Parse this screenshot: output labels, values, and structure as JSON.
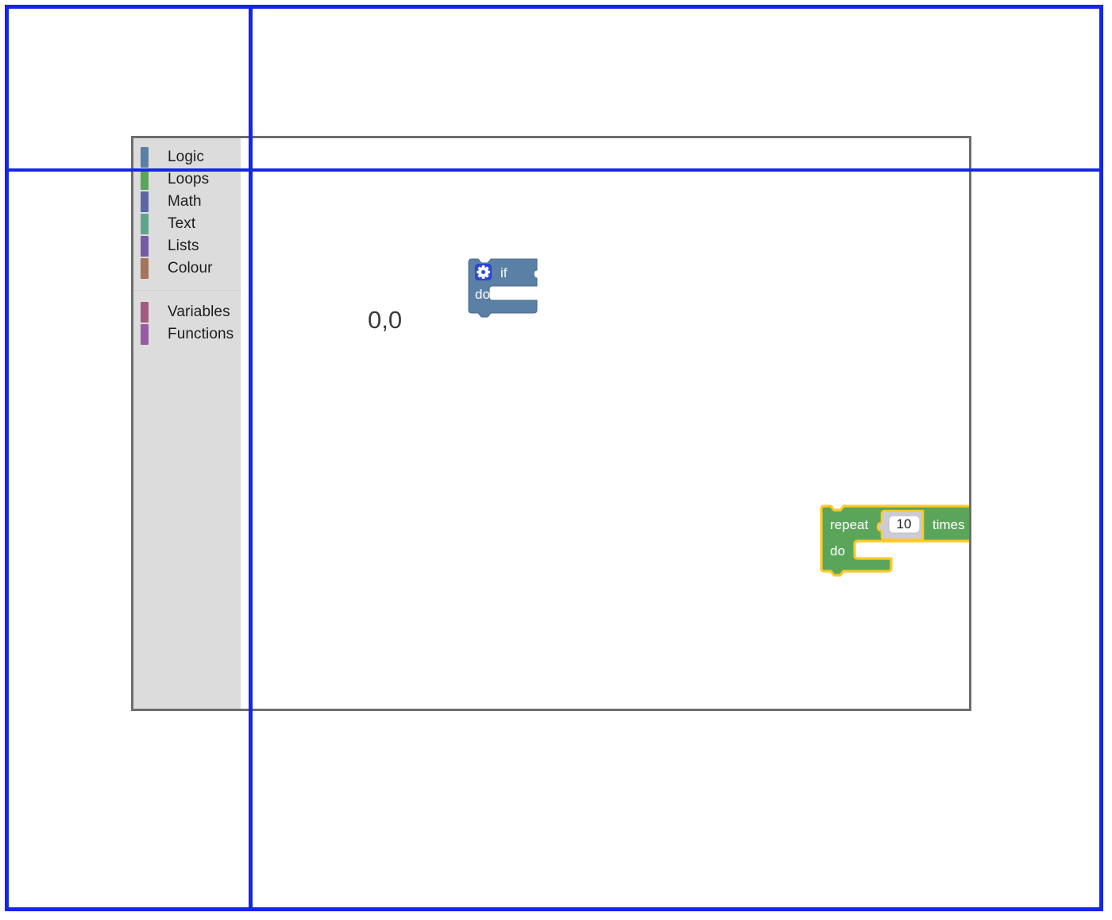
{
  "page": {
    "guides": {
      "frame_color": "#1426e8",
      "vertical_line_x": "313",
      "horizontal_line_y": "212"
    }
  },
  "workspace": {
    "origin_label": "0,0",
    "grid": {
      "spacing": "28.6",
      "dot_color": "#d4d0d4"
    },
    "background_color": "#ffffff",
    "border_color": "#6d6d6d"
  },
  "toolbox": {
    "background_color": "#dcdcdc",
    "categories": [
      {
        "label": "Logic",
        "color": "#5b80a5"
      },
      {
        "label": "Loops",
        "color": "#5ba55b"
      },
      {
        "label": "Math",
        "color": "#5b67a5"
      },
      {
        "label": "Text",
        "color": "#5ba58c"
      },
      {
        "label": "Lists",
        "color": "#745ba5"
      },
      {
        "label": "Colour",
        "color": "#a5745b"
      }
    ],
    "categories_secondary": [
      {
        "label": "Variables",
        "color": "#a55b80"
      },
      {
        "label": "Functions",
        "color": "#995ba5"
      }
    ]
  },
  "blocks": {
    "if_block": {
      "name": "controls_if",
      "mutator_icon": "gear-icon",
      "label_if": "if",
      "label_do": "do",
      "fill_color": "#5b80a5",
      "stroke_color": "#4a6a8a",
      "icon_color": "#2b46d6",
      "selected": "false",
      "x": "456",
      "y": "323"
    },
    "repeat_block": {
      "name": "controls_repeat_ext",
      "label_repeat": "repeat",
      "label_times": "times",
      "label_do": "do",
      "fill_color": "#5ba55b",
      "stroke_color": "#4d8c4d",
      "highlight_color": "#fec927",
      "selected": "true",
      "x": "900",
      "y": "634",
      "number_field": {
        "name": "math_number",
        "value": "10",
        "block_fill": "#ccccd9",
        "field_fill": "#ffffff"
      }
    }
  }
}
